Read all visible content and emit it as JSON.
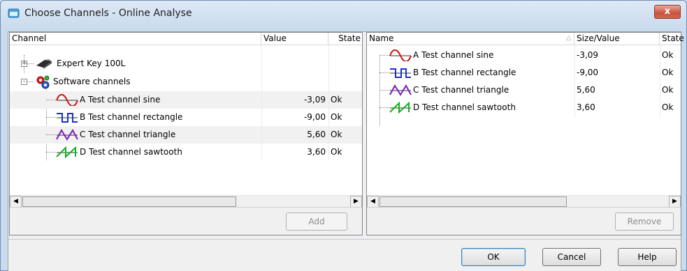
{
  "window": {
    "title": "Choose Channels - Online Analyse",
    "close_label": "x"
  },
  "left_table": {
    "headers": {
      "channel": "Channel",
      "value": "Value",
      "state": "State"
    },
    "device": {
      "label": "Expert Key 100L",
      "expander": "+"
    },
    "group": {
      "label": "Software channels",
      "expander": "-"
    },
    "rows": [
      {
        "name": "A Test channel sine",
        "value": "-3,09",
        "state": "Ok",
        "icon": "sine-wave-icon"
      },
      {
        "name": "B Test channel rectangle",
        "value": "-9,00",
        "state": "Ok",
        "icon": "rectangle-wave-icon"
      },
      {
        "name": "C Test channel triangle",
        "value": "5,60",
        "state": "Ok",
        "icon": "triangle-wave-icon"
      },
      {
        "name": "D Test channel sawtooth",
        "value": "3,60",
        "state": "Ok",
        "icon": "sawtooth-wave-icon"
      }
    ]
  },
  "right_table": {
    "headers": {
      "name": "Name",
      "size_value": "Size/Value",
      "state": "State"
    },
    "rows": [
      {
        "name": "A Test channel sine",
        "value": "-3,09",
        "state": "Ok",
        "icon": "sine-wave-icon"
      },
      {
        "name": "B Test channel rectangle",
        "value": "-9,00",
        "state": "Ok",
        "icon": "rectangle-wave-icon"
      },
      {
        "name": "C Test channel triangle",
        "value": "5,60",
        "state": "Ok",
        "icon": "triangle-wave-icon"
      },
      {
        "name": "D Test channel sawtooth",
        "value": "3,60",
        "state": "Ok",
        "icon": "sawtooth-wave-icon"
      }
    ]
  },
  "buttons": {
    "add": "Add",
    "remove": "Remove",
    "ok": "OK",
    "cancel": "Cancel",
    "help": "Help"
  },
  "scroll": {
    "left_arrow": "◀",
    "right_arrow": "▶"
  },
  "colors": {
    "sine": "#d01010",
    "rectangle": "#1a2fd0",
    "triangle": "#7a20b8",
    "sawtooth": "#14b020"
  }
}
